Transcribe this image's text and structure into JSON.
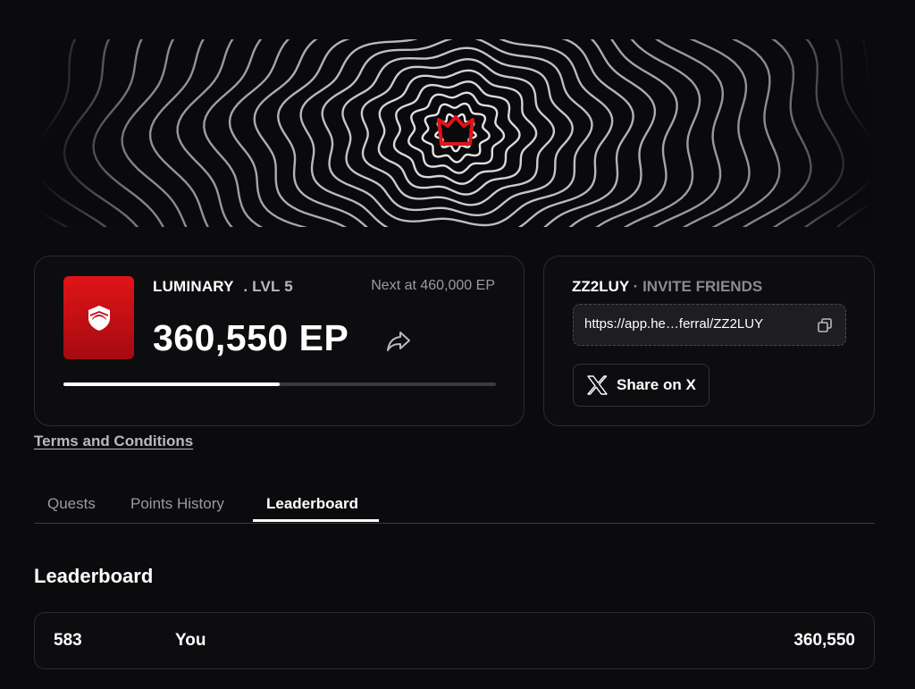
{
  "level_card": {
    "tier_name": "LUMINARY",
    "tier_level": ". LVL 5",
    "next_at": "Next at 460,000 EP",
    "points": "360,550 EP",
    "progress_fraction": 0.5
  },
  "invite_card": {
    "code": "ZZ2LUY",
    "separator": "·",
    "label": "INVITE FRIENDS",
    "link": "https://app.he…ferral/ZZ2LUY",
    "share_label": "Share on X"
  },
  "terms_label": "Terms and Conditions",
  "tabs": [
    {
      "label": "Quests",
      "active": false
    },
    {
      "label": "Points History",
      "active": false
    },
    {
      "label": "Leaderboard",
      "active": true
    }
  ],
  "section_title": "Leaderboard",
  "leaderboard": [
    {
      "rank": "583",
      "name": "You",
      "points": "360,550"
    }
  ],
  "colors": {
    "background": "#0b0b0d",
    "brand_red": "#e01418",
    "muted_text": "#9a9aa0"
  },
  "icons": {
    "banner": "crown-icon",
    "badge": "shield-icon",
    "share": "share-arrow-icon",
    "copy": "copy-icon",
    "x": "x-logo-icon"
  }
}
